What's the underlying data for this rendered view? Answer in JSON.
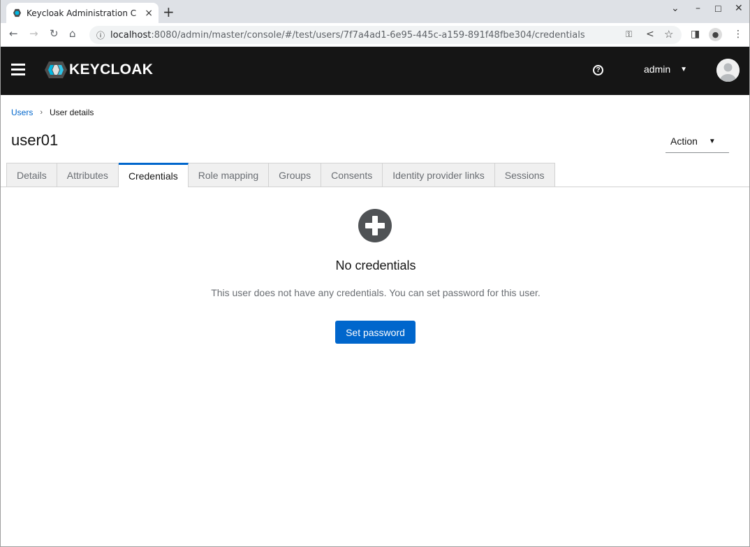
{
  "browser": {
    "tab_title": "Keycloak Administration C",
    "tab_close": "×",
    "new_tab": "+",
    "url_host": "localhost",
    "url_rest": ":8080/admin/master/console/#/test/users/7f7a4ad1-6e95-445c-a159-891f48fbe304/credentials",
    "icons": [
      "back-icon",
      "forward-icon",
      "reload-icon",
      "home-icon",
      "info-icon",
      "key-icon",
      "share-icon",
      "star-icon",
      "side-panel-icon",
      "profile-icon",
      "menu-icon"
    ]
  },
  "header": {
    "logo_text": "KEYCLOAK",
    "help": "?",
    "user": "admin"
  },
  "breadcrumb": {
    "parent": "Users",
    "separator": "›",
    "current": "User details"
  },
  "page": {
    "title": "user01",
    "action_label": "Action"
  },
  "tabs": [
    {
      "label": "Details"
    },
    {
      "label": "Attributes"
    },
    {
      "label": "Credentials",
      "active": true
    },
    {
      "label": "Role mapping"
    },
    {
      "label": "Groups"
    },
    {
      "label": "Consents"
    },
    {
      "label": "Identity provider links"
    },
    {
      "label": "Sessions"
    }
  ],
  "empty_state": {
    "title": "No credentials",
    "body": "This user does not have any credentials. You can set password for this user.",
    "button": "Set password"
  },
  "colors": {
    "accent": "#0066cc",
    "header_bg": "#151515"
  }
}
